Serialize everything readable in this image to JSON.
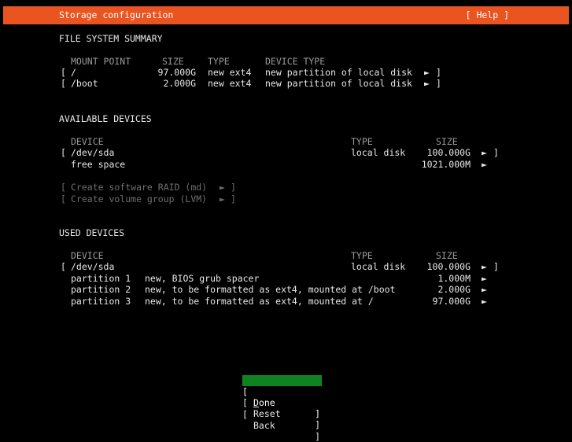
{
  "header": {
    "title": "Storage configuration",
    "help": "[ Help ]"
  },
  "fs_summary": {
    "heading": "FILE SYSTEM SUMMARY",
    "columns": {
      "mount": "MOUNT POINT",
      "size": "SIZE",
      "type": "TYPE",
      "device_type": "DEVICE TYPE"
    },
    "rows": [
      {
        "mount": "/",
        "size": "97.000G",
        "type": "new ext4",
        "device_type": "new partition of local disk"
      },
      {
        "mount": "/boot",
        "size": "2.000G",
        "type": "new ext4",
        "device_type": "new partition of local disk"
      }
    ]
  },
  "available": {
    "heading": "AVAILABLE DEVICES",
    "columns": {
      "device": "DEVICE",
      "type": "TYPE",
      "size": "SIZE"
    },
    "disk": {
      "name": "/dev/sda",
      "type": "local disk",
      "size": "100.000G"
    },
    "free": {
      "name": "free space",
      "size": "1021.000M"
    },
    "actions": [
      "Create software RAID (md)",
      "Create volume group (LVM)"
    ]
  },
  "used": {
    "heading": "USED DEVICES",
    "columns": {
      "device": "DEVICE",
      "type": "TYPE",
      "size": "SIZE"
    },
    "disk": {
      "name": "/dev/sda",
      "type": "local disk",
      "size": "100.000G"
    },
    "partitions": [
      {
        "name": "partition 1",
        "desc": "new, BIOS grub spacer",
        "size": "1.000M"
      },
      {
        "name": "partition 2",
        "desc": "new, to be formatted as ext4, mounted at /boot",
        "size": "2.000G"
      },
      {
        "name": "partition 3",
        "desc": "new, to be formatted as ext4, mounted at /",
        "size": "97.000G"
      }
    ]
  },
  "buttons": {
    "done_hotkey": "D",
    "done_rest": "one",
    "reset": "Reset",
    "back": "Back"
  },
  "glyphs": {
    "lb": "[",
    "rb": "]",
    "arrow": "►"
  },
  "colors": {
    "accent": "#e95420",
    "selected": "#0e8420",
    "background": "#000000"
  }
}
